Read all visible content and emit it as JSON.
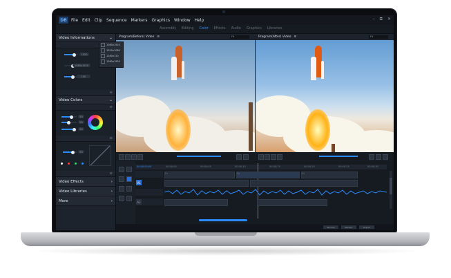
{
  "app": {
    "logo": "DB",
    "menu": [
      "File",
      "Edit",
      "Clip",
      "Sequence",
      "Markers",
      "Graphics",
      "Window",
      "Help"
    ],
    "window_controls": [
      "–",
      "⧉",
      "✕"
    ]
  },
  "workspace_tabs": [
    "Assembly",
    "Editing",
    "Color",
    "Effects",
    "Audio",
    "Graphics",
    "Libraries"
  ],
  "active_tab_index": 2,
  "sidebar": {
    "sections": [
      {
        "label": "Video Informations",
        "state": "expanded",
        "icon": "chevron-down"
      },
      {
        "label": "Video Colors",
        "state": "expanded",
        "icon": "chevron-down"
      },
      {
        "label": "Video Effects",
        "state": "collapsed",
        "icon": "chevron-right"
      },
      {
        "label": "Video Libraries",
        "state": "collapsed",
        "icon": "chevron-right"
      },
      {
        "label": "More",
        "state": "collapsed",
        "icon": "chevron-right"
      }
    ],
    "info": {
      "value_pill_1": "1920",
      "value_pill_2": "1080x1920",
      "value_pill_3": "100",
      "dropdown_options": [
        "1080x1920",
        "1920x1080",
        "1280x720",
        "1080x1920"
      ]
    },
    "colors": {
      "value_pill_1": "50",
      "value_pill_2": "50",
      "value_pill_3": "50",
      "curve_pill": "50",
      "swatches": [
        "#ffffff",
        "#ff3b3b",
        "#3bd16f",
        "#2b8cff"
      ]
    }
  },
  "viewers": [
    {
      "title": "Pragram(Before) Video",
      "fit": "Fit"
    },
    {
      "title": "Pragram(After) Video",
      "fit": "Fit"
    }
  ],
  "timeline": {
    "timecode": "00:00:00:00",
    "ruler_ticks": [
      "00:00:00",
      "00:00:05",
      "00:00:10",
      "00:00:15",
      "00:00:20",
      "00:00:25",
      "00:00:30"
    ],
    "tracks": [
      {
        "tag": "V1",
        "clips": [
          {
            "label": "Fx",
            "sel": false
          },
          {
            "label": "Fx",
            "sel": true
          },
          {
            "label": "Fx",
            "sel": false
          }
        ]
      },
      {
        "tag": "A1",
        "clips": []
      },
      {
        "tag": "A2",
        "clips": [
          {
            "label": "",
            "sel": false
          },
          {
            "label": "",
            "sel": false
          }
        ]
      }
    ],
    "status_buttons": [
      "Normal",
      "Render",
      "Export"
    ]
  },
  "colors": {
    "accent": "#2b8cff",
    "panel": "#1d232c",
    "background": "#10141a"
  }
}
